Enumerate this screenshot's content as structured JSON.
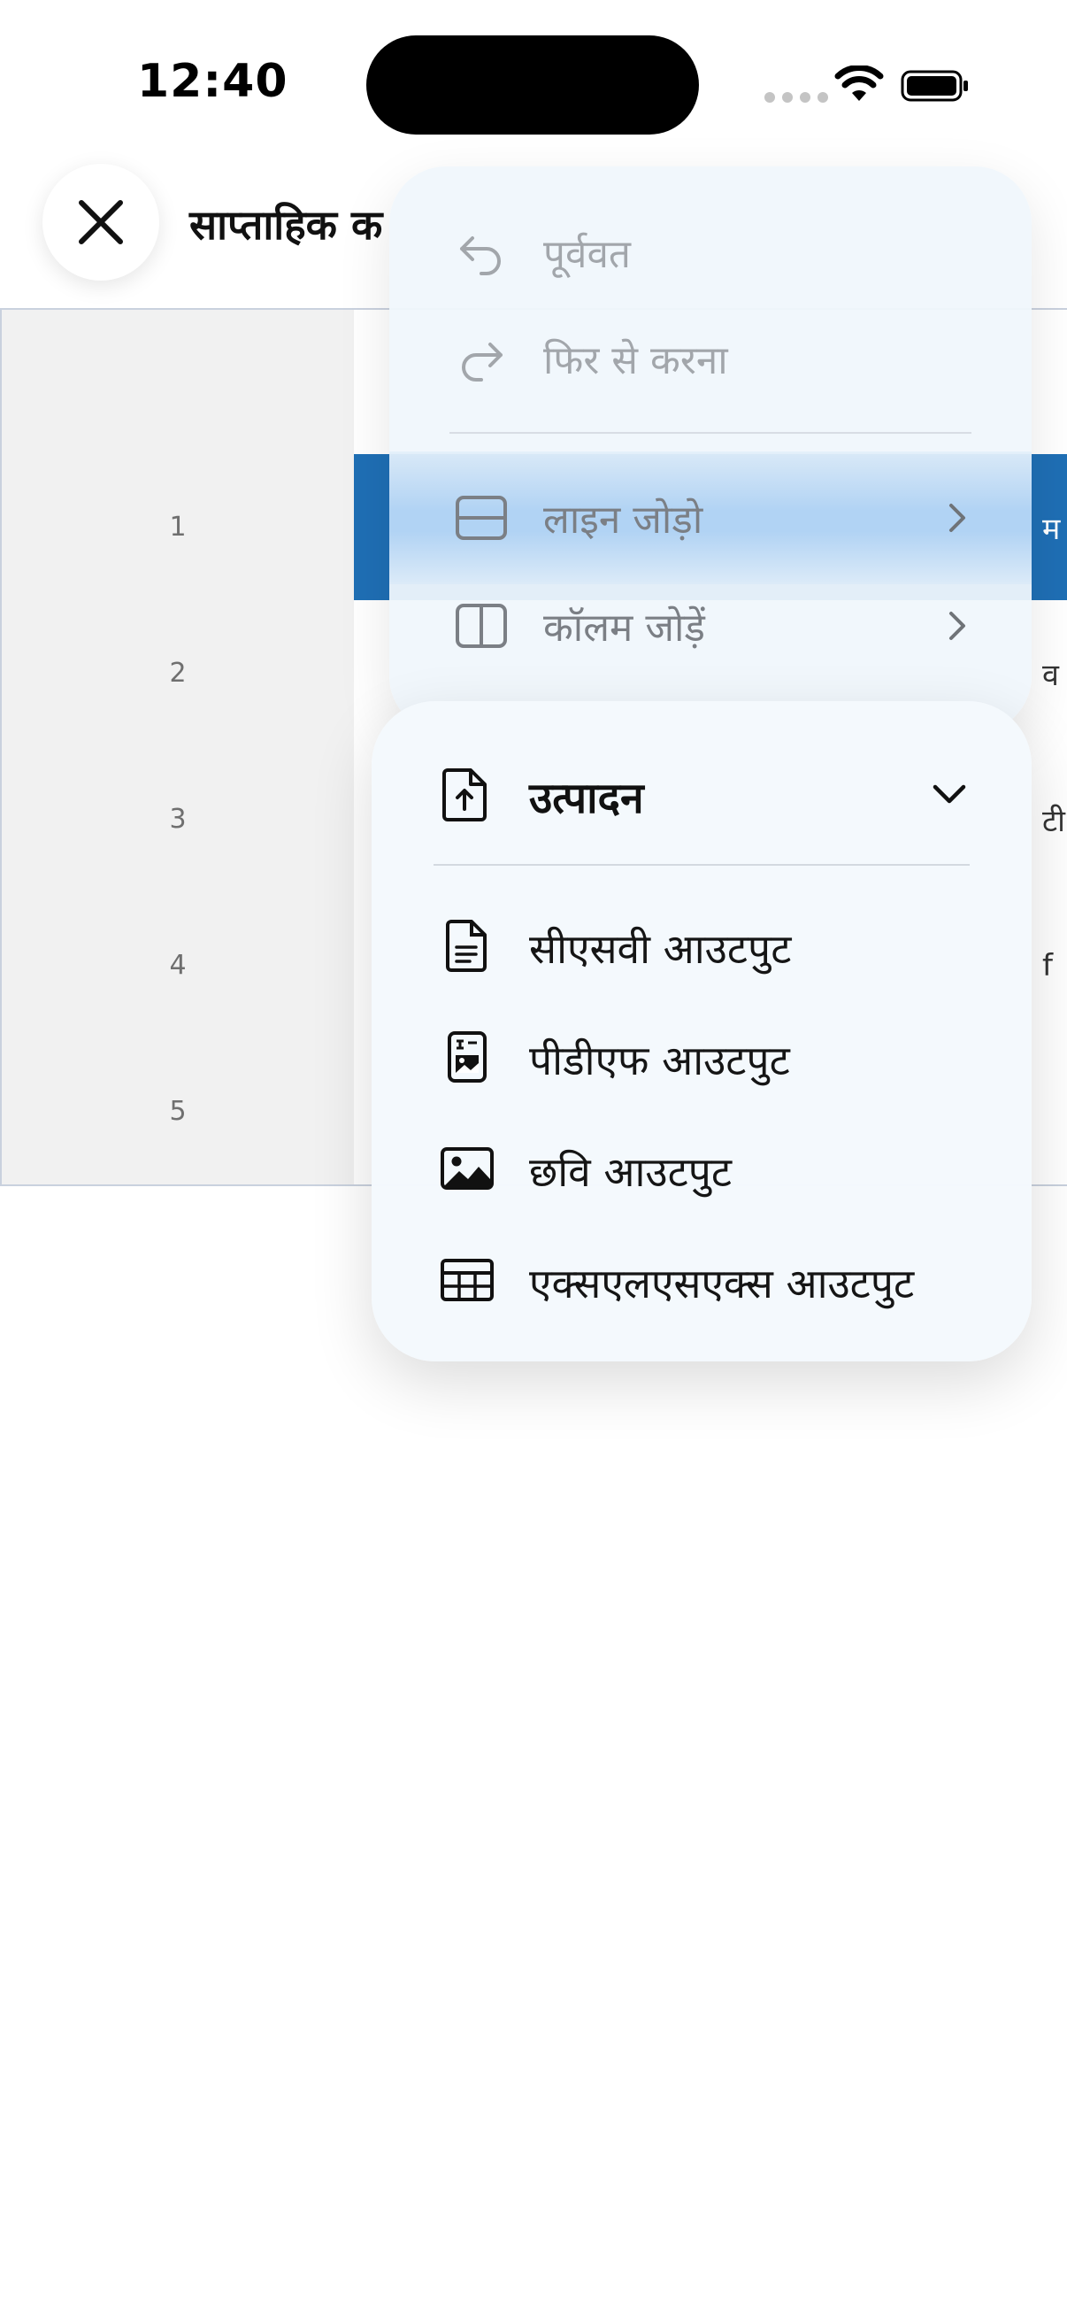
{
  "status_bar": {
    "time": "12:40"
  },
  "header": {
    "title": "साप्ताहिक क"
  },
  "sheet": {
    "rows": [
      {
        "number": "1",
        "edge_text": "म",
        "selected": true
      },
      {
        "number": "2",
        "edge_text": "व",
        "selected": false
      },
      {
        "number": "3",
        "edge_text": "टी",
        "selected": false
      },
      {
        "number": "4",
        "edge_text": "f",
        "selected": false
      },
      {
        "number": "5",
        "edge_text": "",
        "selected": false
      }
    ]
  },
  "context_menu": {
    "undo": "पूर्ववत",
    "redo": "फिर से करना",
    "add_line": "लाइन जोड़ो",
    "add_column": "कॉलम जोड़ें"
  },
  "export_menu": {
    "title": "उत्पादन",
    "items": [
      {
        "label": "सीएसवी आउटपुट",
        "icon": "csv-file-icon"
      },
      {
        "label": "पीडीएफ आउटपुट",
        "icon": "pdf-file-icon"
      },
      {
        "label": "छवि आउटपुट",
        "icon": "image-icon"
      },
      {
        "label": "एक्सएलएसएक्स आउटपुट",
        "icon": "table-icon"
      }
    ]
  },
  "colors": {
    "selected_cell": "#1f6fb5",
    "menu_bg": "#f0f6fc",
    "highlight": "#a8cef3"
  }
}
